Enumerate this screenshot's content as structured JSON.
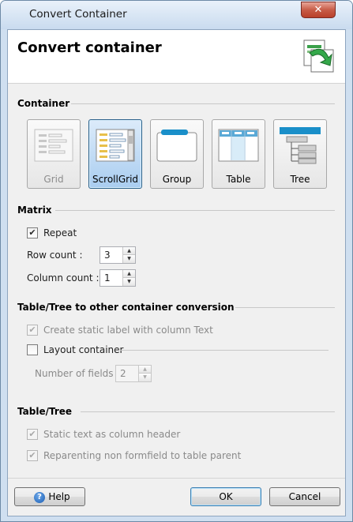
{
  "window": {
    "title": "Convert Container",
    "close_glyph": "✕"
  },
  "header": {
    "title": "Convert container",
    "icon": "convert-document-icon"
  },
  "container_section": {
    "label": "Container",
    "options": [
      {
        "label": "Grid",
        "icon": "grid-icon",
        "state": "disabled"
      },
      {
        "label": "ScrollGrid",
        "icon": "scrollgrid-icon",
        "state": "selected"
      },
      {
        "label": "Group",
        "icon": "group-icon",
        "state": "normal"
      },
      {
        "label": "Table",
        "icon": "table-icon",
        "state": "normal"
      },
      {
        "label": "Tree",
        "icon": "tree-icon",
        "state": "normal"
      }
    ]
  },
  "matrix_section": {
    "label": "Matrix",
    "repeat": {
      "label": "Repeat",
      "checked": true
    },
    "row_count": {
      "label": "Row count :",
      "value": "3"
    },
    "column_count": {
      "label": "Column count :",
      "value": "1"
    }
  },
  "conversion_section": {
    "label": "Table/Tree to other container conversion",
    "static_label": {
      "label": "Create static label with column Text",
      "checked": true,
      "enabled": false
    },
    "layout_container": {
      "label": "Layout container",
      "checked": false
    },
    "number_of_fields": {
      "label": "Number of fields",
      "value": "2",
      "enabled": false
    }
  },
  "table_tree_section": {
    "label": "Table/Tree",
    "static_text_header": {
      "label": "Static text as column header",
      "checked": true,
      "enabled": false
    },
    "reparenting": {
      "label": "Reparenting non formfield to table parent",
      "checked": true,
      "enabled": false
    }
  },
  "footer": {
    "help_label": "Help",
    "ok_label": "OK",
    "cancel_label": "Cancel"
  },
  "colors": {
    "accent": "#3c7fb1",
    "selected_tile": "#a9cdf0",
    "disabled_text": "#8a8a8a"
  }
}
